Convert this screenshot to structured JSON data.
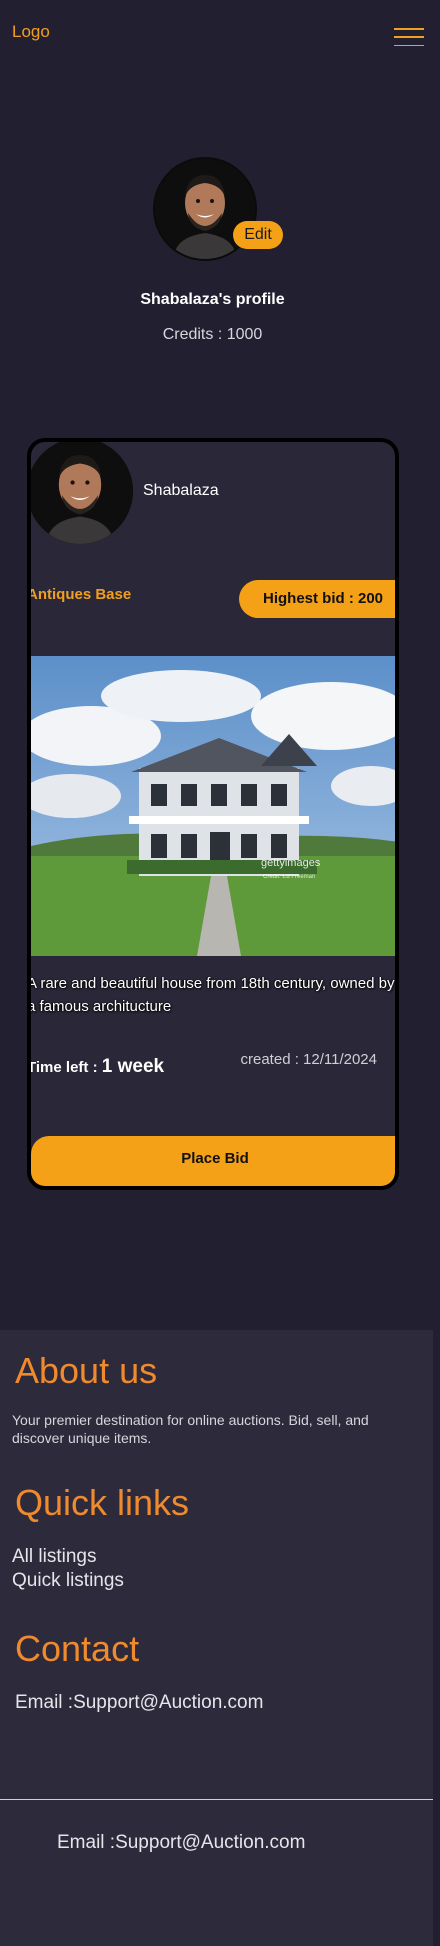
{
  "header": {
    "logo": "Logo",
    "menu_icon": "hamburger-menu-icon",
    "accent": "#f0a020"
  },
  "profile": {
    "name": "Shabalaza's profile",
    "credits": "Credits : 1000",
    "edit_label": "Edit",
    "avatar_icon": "profile-photo"
  },
  "listing": {
    "owner": "Shabalaza",
    "category": "Antiques Base",
    "highest_bid": "Highest bid : 200",
    "watermark": "gettyimages",
    "watermark_credit": "Credit: Ed Freeman",
    "description": "A rare and beautiful house from 18th century, owned by a famous architucture",
    "time_left_label": "Time left",
    "time_left_sep": " : ",
    "time_left_value": "1 week",
    "created": "created : 12/11/2024",
    "place_bid": "Place Bid"
  },
  "footer": {
    "about_heading": "About us",
    "about_text": "Your premier destination for online auctions. Bid, sell, and discover unique items.",
    "links_heading": "Quick links",
    "links": [
      "All listings",
      "Quick listings"
    ],
    "contact_heading": "Contact",
    "contact_email": "Email :Support@Auction.com",
    "bottom_email": "Email :Support@Auction.com",
    "heading_color": "#f08a2c"
  }
}
